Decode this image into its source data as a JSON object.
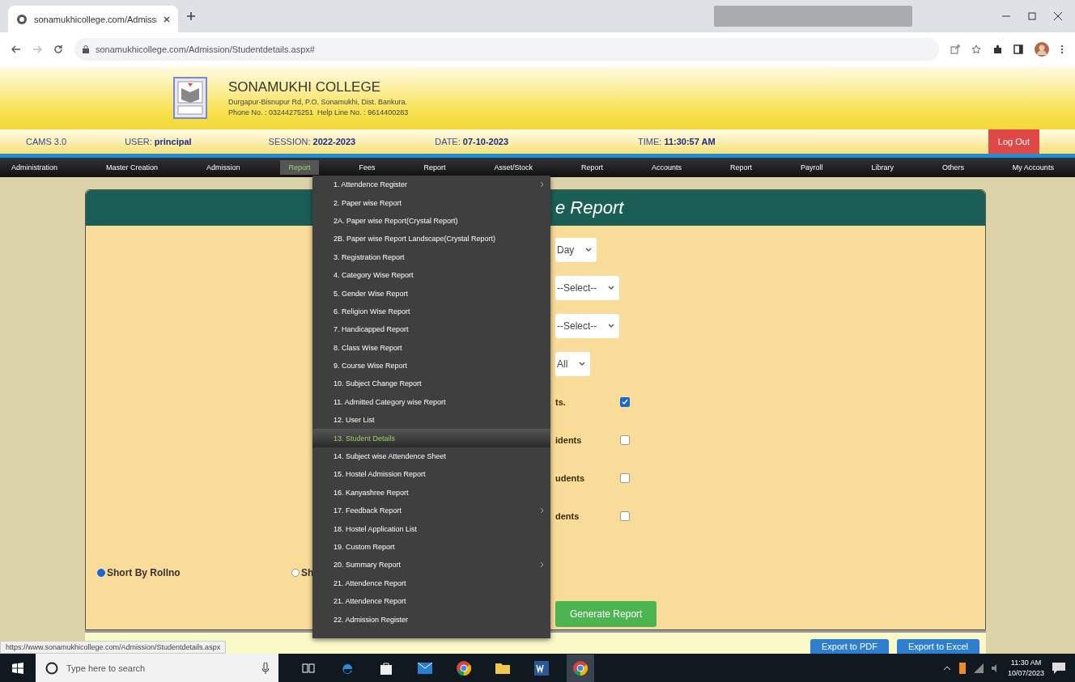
{
  "browser": {
    "tab_title": "sonamukhicollege.com/Admissi",
    "address": "sonamukhicollege.com/Admission/Studentdetails.aspx#"
  },
  "header": {
    "college": "SONAMUKHI COLLEGE",
    "address": "Durgapur-Bisnupur Rd, P.O. Sonamukhi, Dist. Bankura.",
    "phone": "Phone No. : 03244275251  Help Line No. : 9614400283"
  },
  "info_bar": {
    "version": "CAMS 3.0",
    "fields": [
      {
        "label": "USER:",
        "value": "principal"
      },
      {
        "label": "SESSION:",
        "value": "2022-2023"
      },
      {
        "label": "DATE:",
        "value": "07-10-2023"
      },
      {
        "label": "TIME:",
        "value": "11:30:57 AM"
      }
    ],
    "logout": "Log Out"
  },
  "nav": [
    {
      "label": "Administration",
      "selected": false
    },
    {
      "label": "Master Creation",
      "selected": false
    },
    {
      "label": "Admission",
      "selected": false
    },
    {
      "label": "Report",
      "selected": true
    },
    {
      "label": "Fees",
      "selected": false
    },
    {
      "label": "Report",
      "selected": false
    },
    {
      "label": "Asset/Stock",
      "selected": false
    },
    {
      "label": "Report",
      "selected": false
    },
    {
      "label": "Accounts",
      "selected": false
    },
    {
      "label": "Report",
      "selected": false
    },
    {
      "label": "Payroll",
      "selected": false
    },
    {
      "label": "Library",
      "selected": false
    },
    {
      "label": "Others",
      "selected": false
    },
    {
      "label": "My Accounts",
      "selected": false
    }
  ],
  "menu": [
    {
      "label": "1. Attendence Register",
      "selected": false,
      "submenu": true
    },
    {
      "label": "2. Paper wise Report",
      "selected": false,
      "submenu": false
    },
    {
      "label": "2A. Paper wise Report(Crystal Report)",
      "selected": false,
      "submenu": false
    },
    {
      "label": "2B. Paper wise Report Landscape(Crystal Report)",
      "selected": false,
      "submenu": false
    },
    {
      "label": "3. Registration Report",
      "selected": false,
      "submenu": false
    },
    {
      "label": "4. Category Wise Report",
      "selected": false,
      "submenu": false
    },
    {
      "label": "5. Gender Wise Report",
      "selected": false,
      "submenu": false
    },
    {
      "label": "6. Religion Wise Report",
      "selected": false,
      "submenu": false
    },
    {
      "label": "7. Handicapped Report",
      "selected": false,
      "submenu": false
    },
    {
      "label": "8. Class Wise Report",
      "selected": false,
      "submenu": false
    },
    {
      "label": "9. Course Wise Report",
      "selected": false,
      "submenu": false
    },
    {
      "label": "10. Subject Change Report",
      "selected": false,
      "submenu": false
    },
    {
      "label": "11. Admitted Category wise Report",
      "selected": false,
      "submenu": false
    },
    {
      "label": "12. User List",
      "selected": false,
      "submenu": false
    },
    {
      "label": "13. Student Details",
      "selected": true,
      "submenu": false
    },
    {
      "label": "14. Subject wise Attendence Sheet",
      "selected": false,
      "submenu": false
    },
    {
      "label": "15. Hostel Admission Report",
      "selected": false,
      "submenu": false
    },
    {
      "label": "16. Kanyashree Report",
      "selected": false,
      "submenu": false
    },
    {
      "label": "17. Feedback Report",
      "selected": false,
      "submenu": true
    },
    {
      "label": "18. Hostel Application List",
      "selected": false,
      "submenu": false
    },
    {
      "label": "19. Custom Report",
      "selected": false,
      "submenu": false
    },
    {
      "label": "20. Summary Report",
      "selected": false,
      "submenu": true
    },
    {
      "label": "21. Attendence Report",
      "selected": false,
      "submenu": false
    },
    {
      "label": "21. Attendence Report",
      "selected": false,
      "submenu": false
    },
    {
      "label": "22. Admission Register",
      "selected": false,
      "submenu": false
    }
  ],
  "panel": {
    "title": "e Report",
    "rows": [
      {
        "kind": "select",
        "value": "Day"
      },
      {
        "kind": "select",
        "value": "--Select--"
      },
      {
        "kind": "select",
        "value": "--Select--"
      },
      {
        "kind": "select",
        "value": "All"
      },
      {
        "kind": "checkbox",
        "label": "ts.",
        "checked": true
      },
      {
        "kind": "checkbox",
        "label": "idents",
        "checked": false
      },
      {
        "kind": "checkbox",
        "label": "udents",
        "checked": false
      },
      {
        "kind": "checkbox",
        "label": "dents",
        "checked": false
      }
    ],
    "sort_options": [
      {
        "label": "Short By Rollno",
        "selected": true
      },
      {
        "label": "Sh",
        "selected": false
      }
    ],
    "generate": "Generate Report",
    "exports": [
      "Export to PDF",
      "Export to Excel"
    ]
  },
  "status_url": "https://www.sonamukhicollege.com/Admission/Studentdetails.aspx",
  "taskbar": {
    "search_placeholder": "Type here to search",
    "time": "11:30 AM",
    "date": "10/07/2023"
  }
}
